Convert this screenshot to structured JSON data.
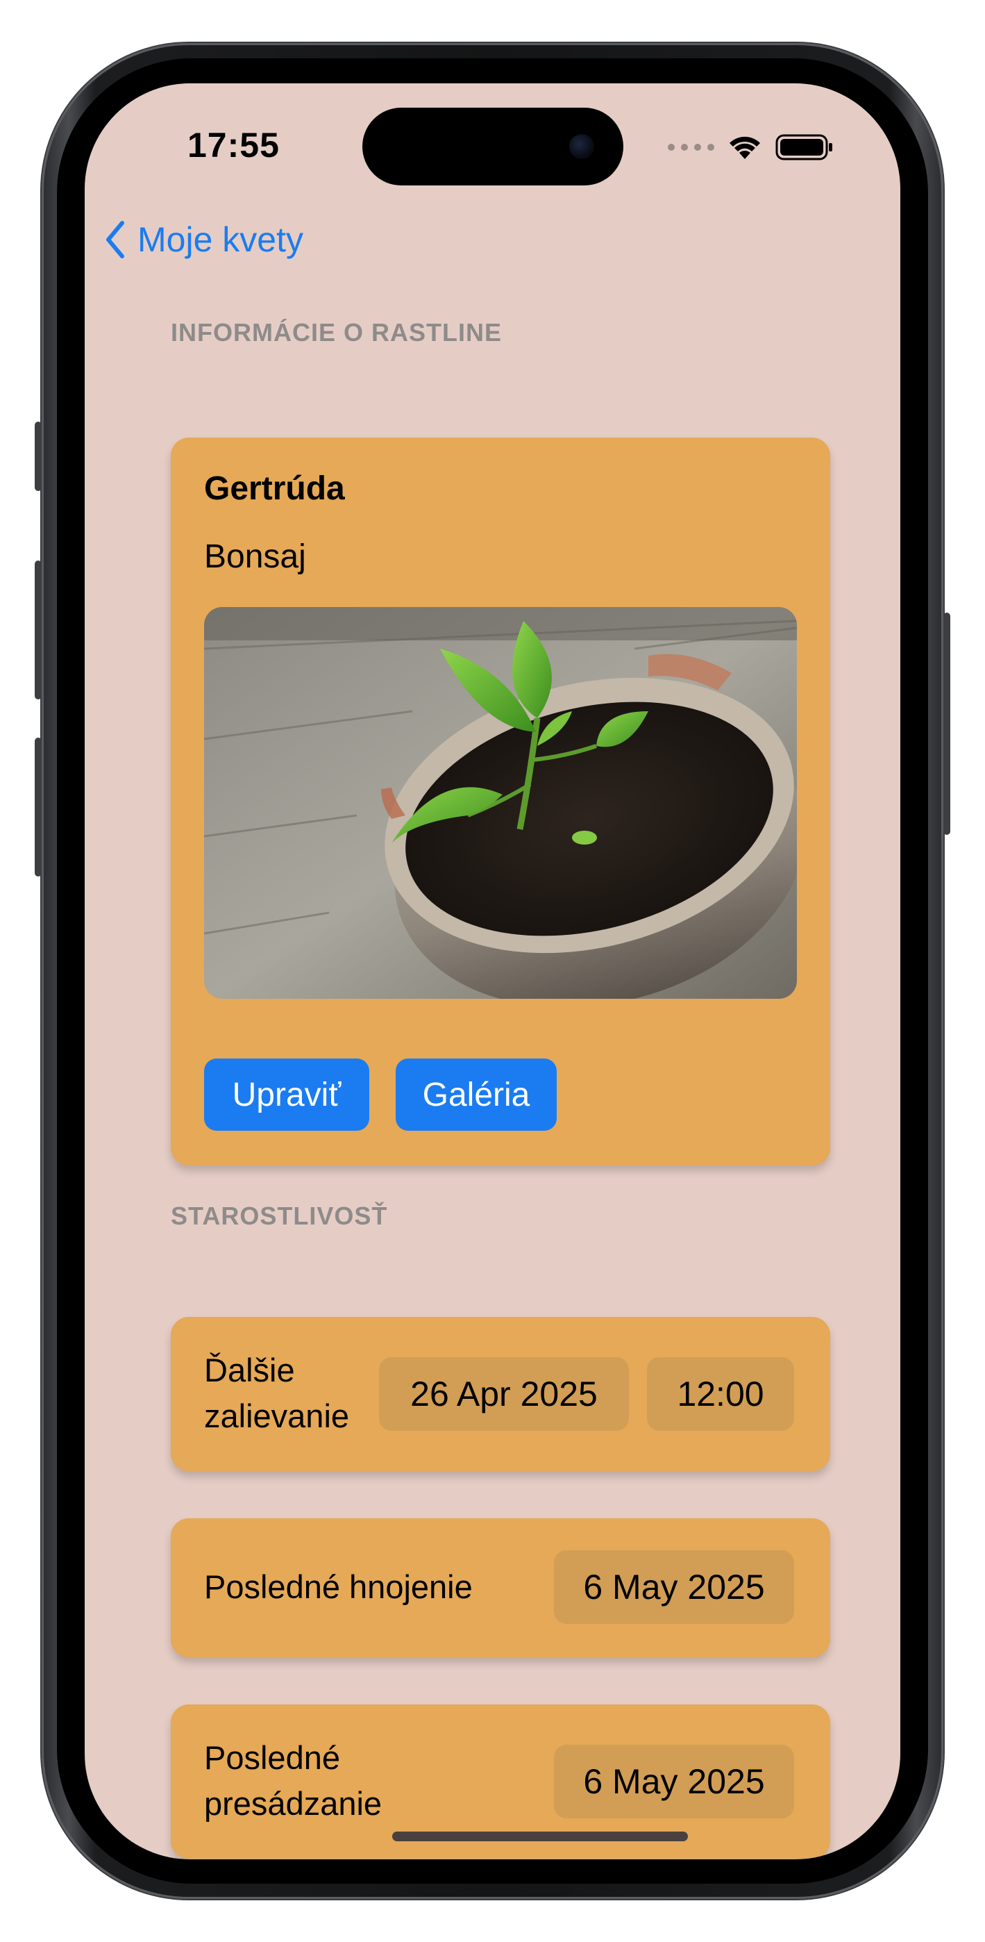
{
  "status_bar": {
    "time": "17:55"
  },
  "nav": {
    "back_label": "Moje kvety"
  },
  "plant_info": {
    "section_title": "INFORMÁCIE O RASTLINE",
    "name": "Gertrúda",
    "species": "Bonsaj",
    "edit_button": "Upraviť",
    "gallery_button": "Galéria"
  },
  "care": {
    "section_title": "STAROSTLIVOSŤ",
    "next_watering": {
      "label_line1": "Ďalšie",
      "label_line2": "zalievanie",
      "date": "26 Apr 2025",
      "time": "12:00"
    },
    "last_fertilizing": {
      "label": "Posledné hnojenie",
      "date": "6 May 2025"
    },
    "last_repotting": {
      "label_line1": "Posledné",
      "label_line2": "presádzanie",
      "date": "6 May 2025"
    }
  },
  "colors": {
    "background": "#e5cdc5",
    "card": "#e5a957",
    "pill": "#d29e55",
    "accent": "#1a7cf0",
    "section_header": "#8e8b8a"
  }
}
